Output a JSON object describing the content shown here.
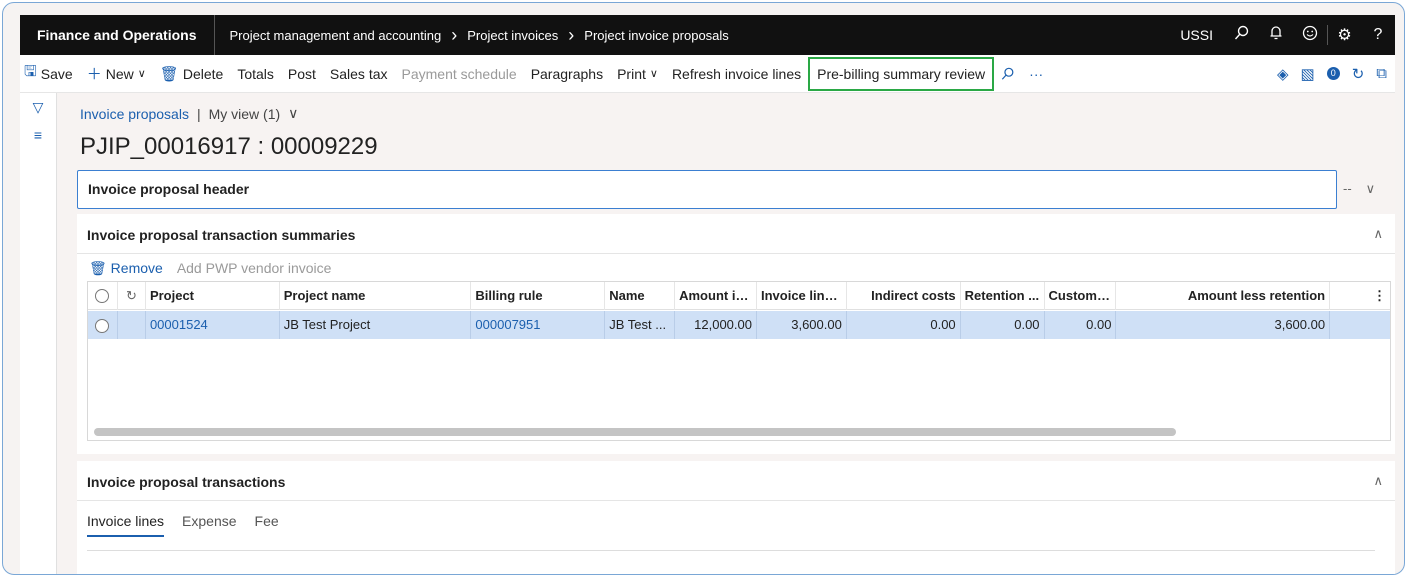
{
  "topbar": {
    "brand": "Finance and Operations",
    "breadcrumbs": [
      "Project management and accounting",
      "Project invoices",
      "Project invoice proposals"
    ],
    "company": "USSI",
    "icons": [
      "search-icon",
      "bell-icon",
      "smiley-icon",
      "gear-icon",
      "help-icon"
    ],
    "help_glyph": "?"
  },
  "actions": {
    "save": "Save",
    "new": "New",
    "delete": "Delete",
    "totals": "Totals",
    "post": "Post",
    "sales_tax": "Sales tax",
    "payment_schedule": "Payment schedule",
    "paragraphs": "Paragraphs",
    "print": "Print",
    "refresh": "Refresh invoice lines",
    "prebilling": "Pre-billing summary review",
    "more": "···",
    "notification_count": "0"
  },
  "view": {
    "link": "Invoice proposals",
    "separator": "|",
    "my_view": "My view (1)"
  },
  "record_title": "PJIP_00016917 : 00009229",
  "header_fasttab": {
    "title": "Invoice proposal header",
    "summary": "--"
  },
  "summaries": {
    "title": "Invoice proposal transaction summaries",
    "remove": "Remove",
    "add_pwp": "Add PWP vendor invoice",
    "columns": [
      "Project",
      "Project name",
      "Billing rule",
      "Name",
      "Amount in...",
      "Invoice line ...",
      "Indirect costs",
      "Retention ...",
      "Customer...",
      "Amount less retention"
    ],
    "rows": [
      {
        "project": "00001524",
        "project_name": "JB Test Project",
        "billing_rule": "000007951",
        "name": "JB Test ...",
        "amount_in": "12,000.00",
        "invoice_line": "3,600.00",
        "indirect_costs": "0.00",
        "retention": "0.00",
        "customer": "0.00",
        "amount_less_retention": "3,600.00"
      }
    ]
  },
  "transactions": {
    "title": "Invoice proposal transactions",
    "tabs": [
      "Invoice lines",
      "Expense",
      "Fee"
    ]
  },
  "colors": {
    "accent": "#1b5fae",
    "highlight_border": "#2aa845",
    "topbar": "#111111",
    "selected_row": "#cfe0f6"
  }
}
